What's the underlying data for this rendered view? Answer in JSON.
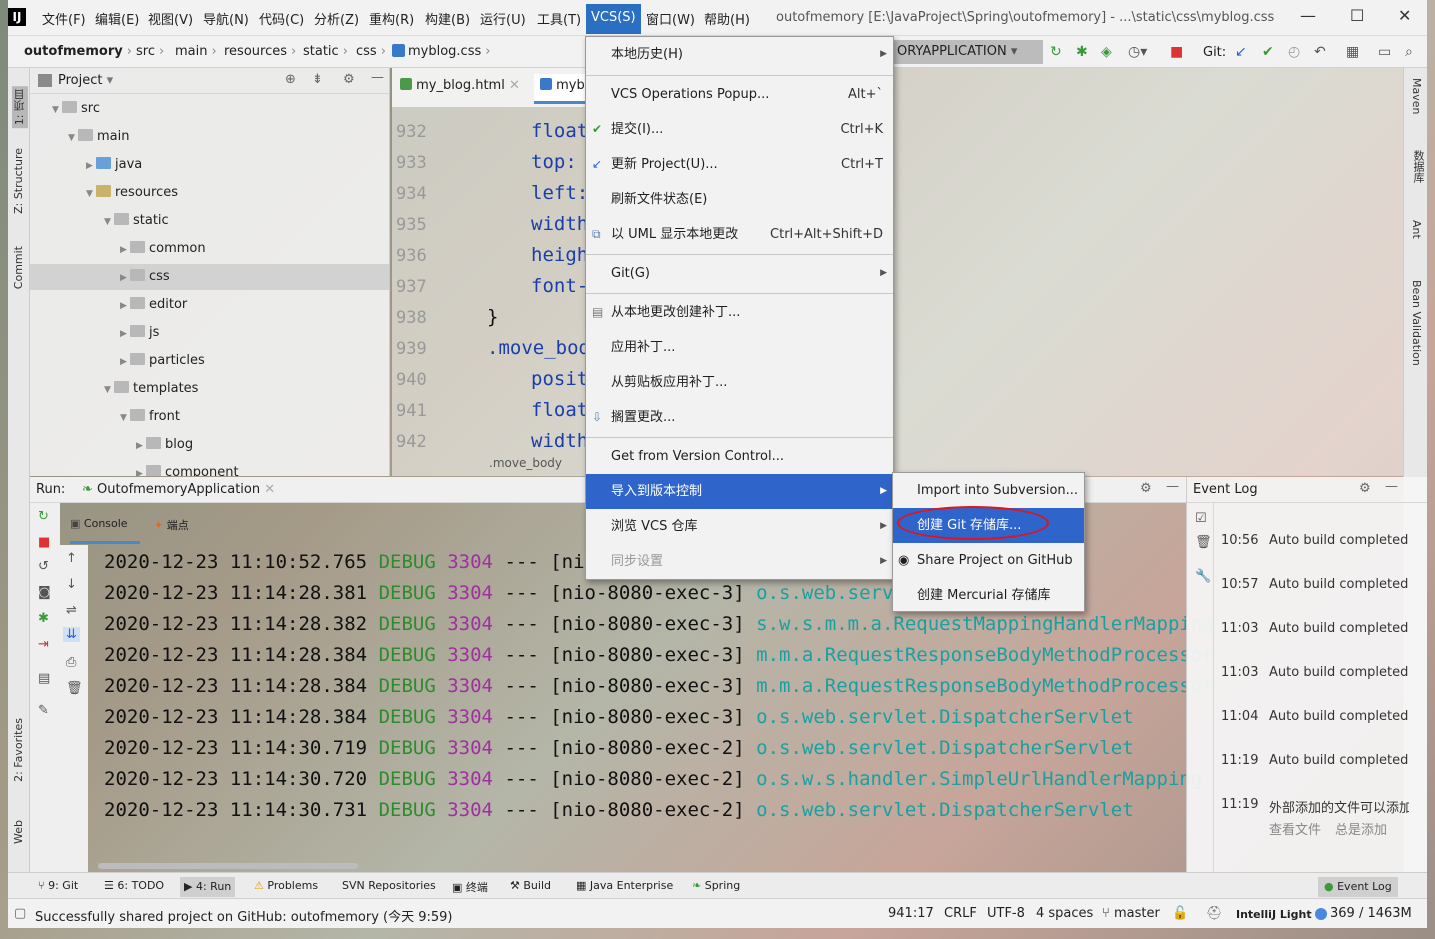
{
  "menubar": {
    "items": [
      "文件(F)",
      "编辑(E)",
      "视图(V)",
      "导航(N)",
      "代码(C)",
      "分析(Z)",
      "重构(R)",
      "构建(B)",
      "运行(U)",
      "工具(T)",
      "VCS(S)",
      "窗口(W)",
      "帮助(H)"
    ],
    "window_title": "outofmemory [E:\\JavaProject\\Spring\\outofmemory] - ...\\static\\css\\myblog.css"
  },
  "breadcrumb": [
    "outofmemory",
    "src",
    "main",
    "resources",
    "static",
    "css",
    "myblog.css"
  ],
  "run_config": "ORYAPPLICATION",
  "git_label": "Git:",
  "project_panel": {
    "title": "Project",
    "tree": [
      {
        "label": "src",
        "depth": 1
      },
      {
        "label": "main",
        "depth": 2
      },
      {
        "label": "java",
        "depth": 3
      },
      {
        "label": "resources",
        "depth": 3
      },
      {
        "label": "static",
        "depth": 4
      },
      {
        "label": "common",
        "depth": 5
      },
      {
        "label": "css",
        "depth": 5
      },
      {
        "label": "editor",
        "depth": 5
      },
      {
        "label": "js",
        "depth": 5
      },
      {
        "label": "particles",
        "depth": 5
      },
      {
        "label": "templates",
        "depth": 4
      },
      {
        "label": "front",
        "depth": 5
      },
      {
        "label": "blog",
        "depth": 6
      },
      {
        "label": "component",
        "depth": 6
      }
    ]
  },
  "editor": {
    "tabs": [
      "my_blog.html",
      "myblo"
    ],
    "line_numbers": [
      "932",
      "933",
      "934",
      "935",
      "936",
      "937",
      "938",
      "939",
      "940",
      "941",
      "942"
    ],
    "code_lines": [
      "float",
      "top:",
      "left:",
      "width",
      "heigh",
      "font-",
      "}",
      ".move_bod",
      "posit",
      "float",
      "width"
    ],
    "breadcrumb": ".move_body"
  },
  "left_stripe": [
    "1: 项目",
    "Z: Structure",
    "Commit",
    "2: Favorites",
    "Web"
  ],
  "right_stripe": [
    "Maven",
    "数据库",
    "Ant",
    "Bean Validation"
  ],
  "vcs_menu": {
    "items": [
      {
        "label": "本地历史(H)",
        "shortcut": "",
        "submenu": true
      },
      {
        "label": "VCS Operations Popup...",
        "shortcut": "Alt+`",
        "submenu": false
      },
      {
        "label": "提交(I)...",
        "shortcut": "Ctrl+K",
        "submenu": false
      },
      {
        "label": "更新 Project(U)...",
        "shortcut": "Ctrl+T",
        "submenu": false
      },
      {
        "label": "刷新文件状态(E)",
        "shortcut": "",
        "submenu": false
      },
      {
        "label": "以 UML 显示本地更改",
        "shortcut": "Ctrl+Alt+Shift+D",
        "submenu": false
      },
      {
        "label": "Git(G)",
        "shortcut": "",
        "submenu": true
      },
      {
        "label": "从本地更改创建补丁...",
        "shortcut": "",
        "submenu": false
      },
      {
        "label": "应用补丁...",
        "shortcut": "",
        "submenu": false
      },
      {
        "label": "从剪贴板应用补丁...",
        "shortcut": "",
        "submenu": false
      },
      {
        "label": "搁置更改...",
        "shortcut": "",
        "submenu": false
      },
      {
        "label": "Get from Version Control...",
        "shortcut": "",
        "submenu": false
      },
      {
        "label": "导入到版本控制",
        "shortcut": "",
        "submenu": true
      },
      {
        "label": "浏览 VCS 仓库",
        "shortcut": "",
        "submenu": true
      },
      {
        "label": "同步设置",
        "shortcut": "",
        "submenu": true
      }
    ]
  },
  "sub_menu": {
    "items": [
      "Import into Subversion...",
      "创建 Git 存储库...",
      "Share Project on GitHub",
      "创建 Mercurial 存储库"
    ]
  },
  "run_panel": {
    "title": "Run:",
    "config": "OutofmemoryApplication",
    "tabs": [
      "Console",
      "端点"
    ],
    "logs": [
      {
        "ts": "2020-12-23 11:10:52.765",
        "level": "DEBUG",
        "pid": "3304",
        "sep": "---",
        "thread": "[nio-",
        "cls": ""
      },
      {
        "ts": "2020-12-23 11:14:28.381",
        "level": "DEBUG",
        "pid": "3304",
        "sep": "---",
        "thread": "[nio-8080-exec-3]",
        "cls": "o.s.web.servlet"
      },
      {
        "ts": "2020-12-23 11:14:28.382",
        "level": "DEBUG",
        "pid": "3304",
        "sep": "---",
        "thread": "[nio-8080-exec-3]",
        "cls": "s.w.s.m.m.a.RequestMappingHandlerMapping"
      },
      {
        "ts": "2020-12-23 11:14:28.384",
        "level": "DEBUG",
        "pid": "3304",
        "sep": "---",
        "thread": "[nio-8080-exec-3]",
        "cls": "m.m.a.RequestResponseBodyMethodProcessor"
      },
      {
        "ts": "2020-12-23 11:14:28.384",
        "level": "DEBUG",
        "pid": "3304",
        "sep": "---",
        "thread": "[nio-8080-exec-3]",
        "cls": "m.m.a.RequestResponseBodyMethodProcessor"
      },
      {
        "ts": "2020-12-23 11:14:28.384",
        "level": "DEBUG",
        "pid": "3304",
        "sep": "---",
        "thread": "[nio-8080-exec-3]",
        "cls": "o.s.web.servlet.DispatcherServlet"
      },
      {
        "ts": "2020-12-23 11:14:30.719",
        "level": "DEBUG",
        "pid": "3304",
        "sep": "---",
        "thread": "[nio-8080-exec-2]",
        "cls": "o.s.web.servlet.DispatcherServlet"
      },
      {
        "ts": "2020-12-23 11:14:30.720",
        "level": "DEBUG",
        "pid": "3304",
        "sep": "---",
        "thread": "[nio-8080-exec-2]",
        "cls": "o.s.w.s.handler.SimpleUrlHandlerMapping"
      },
      {
        "ts": "2020-12-23 11:14:30.731",
        "level": "DEBUG",
        "pid": "3304",
        "sep": "---",
        "thread": "[nio-8080-exec-2]",
        "cls": "o.s.web.servlet.DispatcherServlet"
      }
    ]
  },
  "event_log": {
    "title": "Event Log",
    "entries": [
      {
        "time": "10:56",
        "msg": "Auto build completed"
      },
      {
        "time": "10:57",
        "msg": "Auto build completed"
      },
      {
        "time": "11:03",
        "msg": "Auto build completed"
      },
      {
        "time": "11:03",
        "msg": "Auto build completed"
      },
      {
        "time": "11:04",
        "msg": "Auto build completed"
      },
      {
        "time": "11:19",
        "msg": "Auto build completed"
      },
      {
        "time": "11:19",
        "msg": "外部添加的文件可以添加"
      }
    ],
    "links": [
      "查看文件",
      "总是添加"
    ]
  },
  "tool_tabs": [
    "9: Git",
    "6: TODO",
    "4: Run",
    "Problems",
    "SVN Repositories",
    "终端",
    "Build",
    "Java Enterprise",
    "Spring",
    "Event Log"
  ],
  "status_bar": {
    "message": "Successfully shared project on GitHub: outofmemory (今天 9:59)",
    "position": "941:17",
    "line_sep": "CRLF",
    "encoding": "UTF-8",
    "indent": "4 spaces",
    "branch": "master",
    "theme": "IntelliJ Light",
    "memory": "369 / 1463M"
  },
  "colors": {
    "accent": "#2f65ca",
    "annotation": "#e3131b"
  }
}
